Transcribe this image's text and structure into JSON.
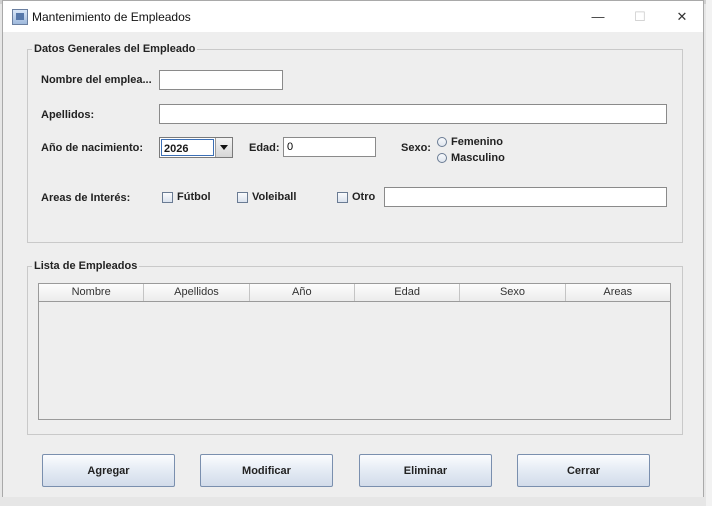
{
  "window": {
    "title": "Mantenimiento de Empleados",
    "minimize": "—",
    "maximize": "☐",
    "close": "✕"
  },
  "datos": {
    "legend": "Datos Generales del Empleado",
    "nombre_label": "Nombre del emplea...",
    "nombre_value": "",
    "apellidos_label": "Apellidos:",
    "apellidos_value": "",
    "anio_label": "Año de nacimiento:",
    "anio_value": "2026",
    "edad_label": "Edad:",
    "edad_value": "0",
    "sexo_label": "Sexo:",
    "sexo_options": [
      "Femenino",
      "Masculino"
    ],
    "areas_label": "Areas de Interés:",
    "areas_options": [
      "Fútbol",
      "Voleiball",
      "Otro"
    ],
    "otro_value": ""
  },
  "lista": {
    "legend": "Lista de Empleados",
    "columns": [
      "Nombre",
      "Apellidos",
      "Año",
      "Edad",
      "Sexo",
      "Areas"
    ],
    "rows": []
  },
  "buttons": {
    "agregar": "Agregar",
    "modificar": "Modificar",
    "eliminar": "Eliminar",
    "cerrar": "Cerrar"
  }
}
